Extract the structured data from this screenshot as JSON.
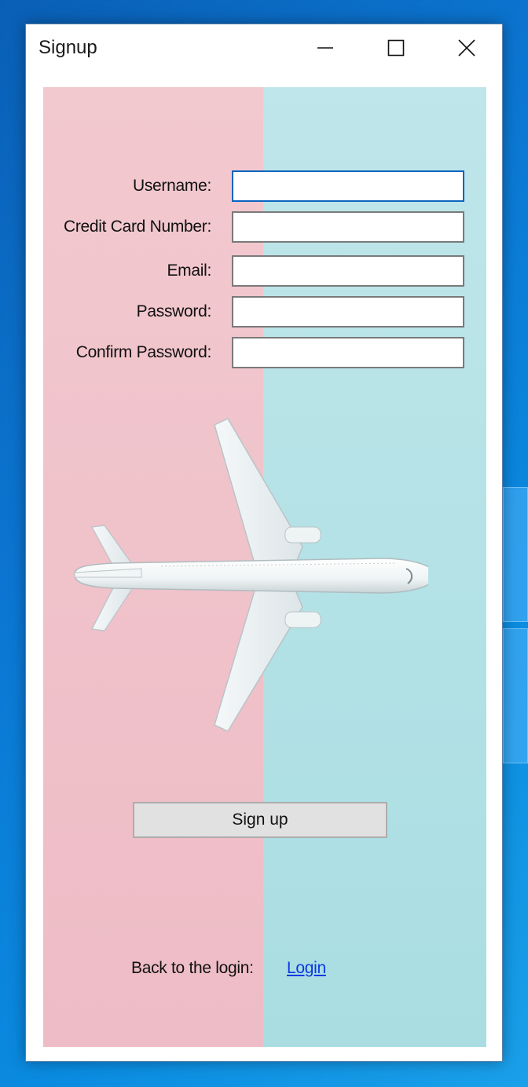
{
  "window": {
    "title": "Signup"
  },
  "form": {
    "fields": [
      {
        "label": "Username:",
        "value": ""
      },
      {
        "label": "Credit Card Number:",
        "value": ""
      },
      {
        "label": "Email:",
        "value": ""
      },
      {
        "label": "Password:",
        "value": ""
      },
      {
        "label": "Confirm Password:",
        "value": ""
      }
    ],
    "submit_label": "Sign up"
  },
  "footer": {
    "back_label": "Back to the login:",
    "login_link": "Login"
  },
  "icons": {
    "minimize": "minimize-icon",
    "maximize": "maximize-icon",
    "close": "close-icon",
    "background": "airplane-image"
  },
  "colors": {
    "pink_background": "#f0c2ca",
    "teal_background": "#b4e2e6",
    "focused_border": "#0a64c2",
    "link": "#0a3ae0"
  }
}
